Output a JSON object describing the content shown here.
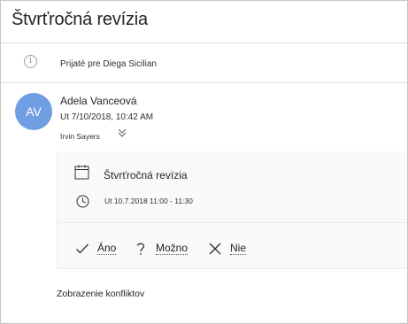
{
  "message": {
    "subject": "Štvrťročná revízia",
    "received_for": "Prijaté pre Diega Sicilian",
    "sender": {
      "initials": "AV",
      "name": "Adela Vanceová",
      "sent": "Ut 7/10/2018, 10:42 AM",
      "to": "Irvin Sayers"
    }
  },
  "meeting_card": {
    "title": "Štvrťročná revízia",
    "time": "Ut 10.7.2018 11:00 - 11:30"
  },
  "responses": {
    "accept_label": "Áno",
    "tentative_label": "Možno",
    "decline_label": "Nie"
  },
  "conflicts": {
    "label": "Zobrazenie konfliktov"
  },
  "colors": {
    "avatar_bg": "#6f9fe2",
    "card_bg": "#faf9f8",
    "border": "#c8c6c4"
  },
  "icons": [
    "info-icon",
    "chevron-double-down-icon",
    "calendar-icon",
    "clock-icon",
    "checkmark-icon",
    "question-icon",
    "close-icon"
  ]
}
